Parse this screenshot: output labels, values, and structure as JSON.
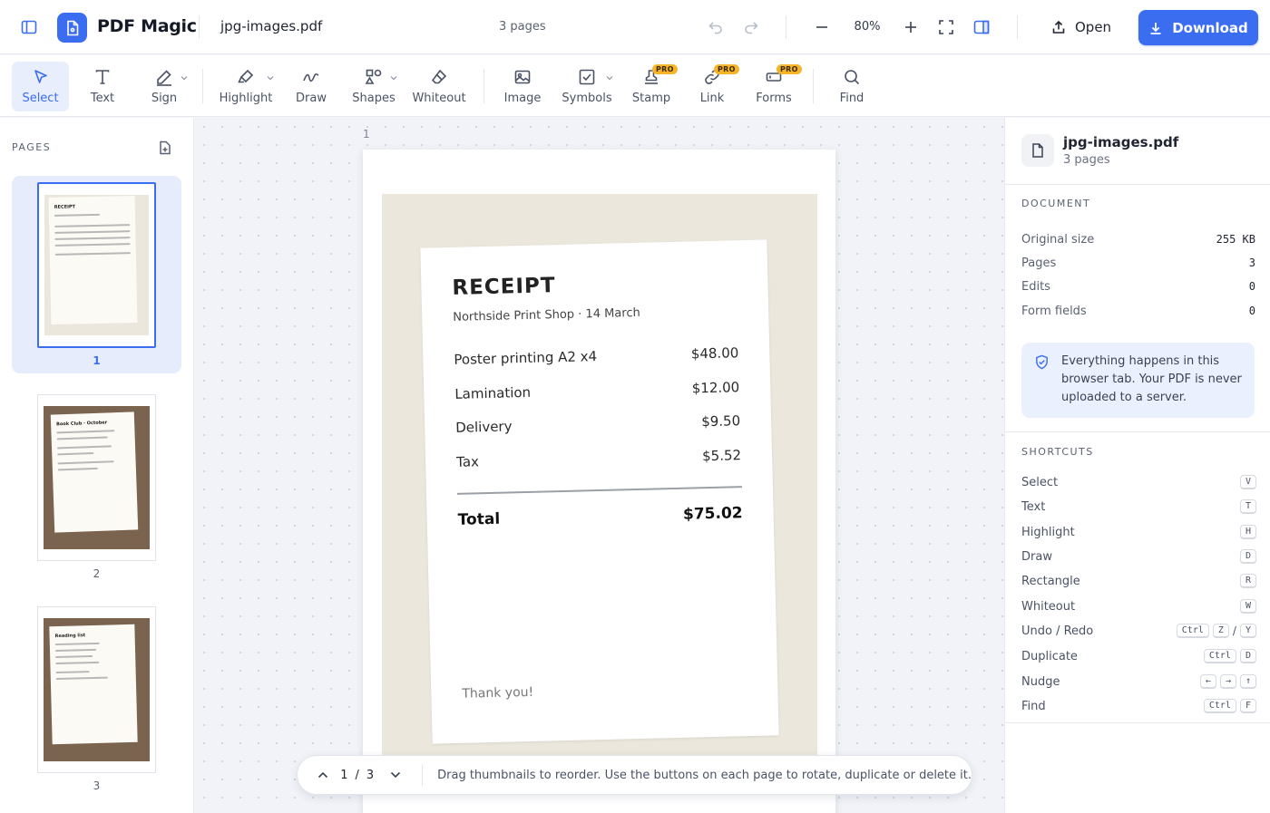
{
  "app": {
    "name": "PDF Magic"
  },
  "header": {
    "file_name": "jpg-images.pdf",
    "page_count": "3 pages",
    "zoom": "80%",
    "open_label": "Open",
    "download_label": "Download"
  },
  "toolbar": {
    "tools": [
      {
        "label": "Select",
        "icon": "cursor-icon",
        "active": true
      },
      {
        "label": "Text",
        "icon": "text-icon"
      },
      {
        "label": "Sign",
        "icon": "signature-icon",
        "dropdown": true
      },
      {
        "label": "Highlight",
        "icon": "highlighter-icon",
        "dropdown": true
      },
      {
        "label": "Draw",
        "icon": "squiggle-icon"
      },
      {
        "label": "Shapes",
        "icon": "shapes-icon",
        "dropdown": true
      },
      {
        "label": "Whiteout",
        "icon": "eraser-icon"
      },
      {
        "label": "Image",
        "icon": "image-icon"
      },
      {
        "label": "Symbols",
        "icon": "checkbox-icon",
        "dropdown": true
      },
      {
        "label": "Stamp",
        "icon": "stamp-icon",
        "pro": true,
        "dropdown": true
      },
      {
        "label": "Link",
        "icon": "link-icon",
        "pro": true
      },
      {
        "label": "Forms",
        "icon": "form-icon",
        "pro": true,
        "dropdown": true
      },
      {
        "label": "Find",
        "icon": "search-icon"
      }
    ],
    "pro_badge": "PRO"
  },
  "sidebar": {
    "title": "PAGES",
    "pages": [
      {
        "number": "1",
        "selected": true
      },
      {
        "number": "2"
      },
      {
        "number": "3"
      }
    ],
    "thumb_titles": [
      "RECEIPT",
      "Book Club · October",
      "Reading list"
    ]
  },
  "canvas": {
    "page_label": "1",
    "receipt": {
      "title": "RECEIPT",
      "subtitle": "Northside Print Shop · 14 March",
      "items": [
        {
          "name": "Poster printing A2 x4",
          "price": "$48.00"
        },
        {
          "name": "Lamination",
          "price": "$12.00"
        },
        {
          "name": "Delivery",
          "price": "$9.50"
        },
        {
          "name": "Tax",
          "price": "$5.52"
        }
      ],
      "total_label": "Total",
      "total_value": "$75.02",
      "thanks": "Thank you!"
    },
    "pager": {
      "current": "1",
      "separator": "/",
      "total": "3",
      "hint": "Drag thumbnails to reorder. Use the buttons on each page to rotate, duplicate or delete it."
    }
  },
  "panel": {
    "doc_name": "jpg-images.pdf",
    "doc_pages": "3 pages",
    "document_title": "DOCUMENT",
    "stats": [
      {
        "label": "Original size",
        "value": "255 KB"
      },
      {
        "label": "Pages",
        "value": "3"
      },
      {
        "label": "Edits",
        "value": "0"
      },
      {
        "label": "Form fields",
        "value": "0"
      }
    ],
    "notice": "Everything happens in this browser tab. Your PDF is never uploaded to a server.",
    "shortcuts_title": "SHORTCUTS",
    "shortcuts": [
      {
        "label": "Select",
        "keys": [
          "V"
        ]
      },
      {
        "label": "Text",
        "keys": [
          "T"
        ]
      },
      {
        "label": "Highlight",
        "keys": [
          "H"
        ]
      },
      {
        "label": "Draw",
        "keys": [
          "D"
        ]
      },
      {
        "label": "Rectangle",
        "keys": [
          "R"
        ]
      },
      {
        "label": "Whiteout",
        "keys": [
          "W"
        ]
      },
      {
        "label": "Undo / Redo",
        "keys": [
          "Ctrl",
          "Z",
          "/",
          "Y"
        ]
      },
      {
        "label": "Duplicate",
        "keys": [
          "Ctrl",
          "D"
        ]
      },
      {
        "label": "Nudge",
        "keys": [
          "←",
          "→",
          "↑"
        ]
      },
      {
        "label": "Find",
        "keys": [
          "Ctrl",
          "F"
        ]
      }
    ]
  },
  "colors": {
    "accent": "#3b6df0",
    "pro_badge": "#f6b429",
    "photo_tan": "#ebe7dd",
    "photo_brown": "#7a6450"
  }
}
